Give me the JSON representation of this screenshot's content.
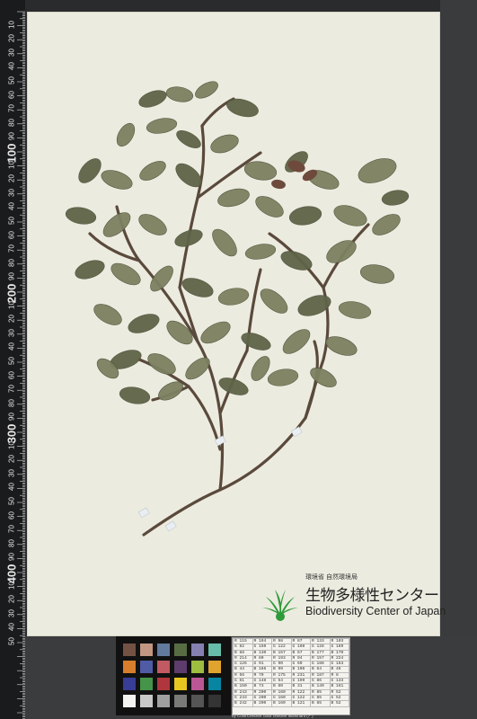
{
  "ruler": {
    "top_tag": "",
    "major_labels": [
      "100",
      "200",
      "300",
      "400",
      "500"
    ],
    "minor_labels": [
      "10",
      "20",
      "30",
      "40",
      "50",
      "60",
      "70",
      "80",
      "90",
      "10",
      "20",
      "30",
      "40",
      "50",
      "60",
      "70",
      "80",
      "90",
      "10",
      "20",
      "30",
      "40",
      "50",
      "60",
      "70",
      "80",
      "90",
      "10",
      "20",
      "30",
      "40",
      "50",
      "60",
      "70",
      "80",
      "90",
      "10",
      "20",
      "30",
      "40",
      "50"
    ]
  },
  "logo": {
    "line1": "環境省 自然環境局",
    "line2": "生物多様性センター",
    "line3": "Biodiversity Center of Japan",
    "mark_color": "#2f9a3a"
  },
  "color_chart": {
    "credit": "by ColorChecker color checker Illuminant (7°)",
    "rows": [
      [
        "R 115",
        "R 194",
        "R 98",
        "R 87",
        "R 133",
        "R 103"
      ],
      [
        "G 82",
        "G 150",
        "G 122",
        "G 108",
        "G 128",
        "G 189"
      ],
      [
        "B 68",
        "B 130",
        "B 157",
        "B 67",
        "B 177",
        "B 170"
      ],
      [
        "R 214",
        "R 80",
        "R 193",
        "R 94",
        "R 157",
        "R 224"
      ],
      [
        "G 126",
        "G 91",
        "G 90",
        "G 60",
        "G 188",
        "G 163"
      ],
      [
        "B 44",
        "B 166",
        "B 99",
        "B 108",
        "B 64",
        "B 46"
      ],
      [
        "R 56",
        "R 70",
        "R 175",
        "R 231",
        "R 187",
        "R 8"
      ],
      [
        "G 61",
        "G 148",
        "G 54",
        "G 199",
        "G 86",
        "G 133"
      ],
      [
        "B 150",
        "B 73",
        "B 60",
        "B 31",
        "B 149",
        "B 161"
      ],
      [
        "R 243",
        "R 200",
        "R 160",
        "R 122",
        "R 85",
        "R 52"
      ],
      [
        "G 243",
        "G 200",
        "G 160",
        "G 122",
        "G 85",
        "G 52"
      ],
      [
        "B 242",
        "B 200",
        "B 160",
        "B 121",
        "B 85",
        "B 52"
      ]
    ]
  },
  "swatch_colors": [
    "#735244",
    "#c29682",
    "#627a9d",
    "#576c43",
    "#8580b1",
    "#67bdaa",
    "#d67e2c",
    "#505ba6",
    "#c15a63",
    "#5e3c6c",
    "#9dbc40",
    "#e0a32e",
    "#383d96",
    "#469449",
    "#af363c",
    "#e7c71f",
    "#bb5695",
    "#0885a1",
    "#f3f3f2",
    "#c8c8c8",
    "#a0a0a0",
    "#7a7a79",
    "#555555",
    "#343434"
  ],
  "specimen": {
    "leaf_color": "#7d8160",
    "leaf_dark": "#5f6448",
    "stem_color": "#5a4a3c",
    "tag_color": "#e8eef2"
  }
}
